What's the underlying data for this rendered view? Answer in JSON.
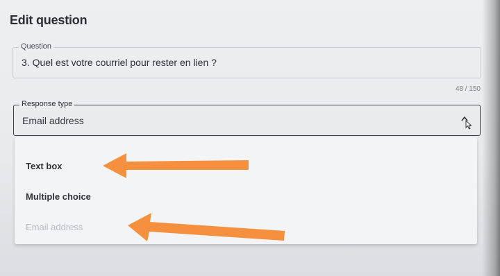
{
  "page_title": "Edit question",
  "question": {
    "legend": "Question",
    "value": "3. Quel est votre courriel pour rester en lien ?",
    "counter": "48 / 150"
  },
  "response_type": {
    "legend": "Response type",
    "selected": "Email address"
  },
  "options": [
    {
      "label": "Text box"
    },
    {
      "label": "Multiple choice"
    },
    {
      "label": "Email address"
    }
  ],
  "colors": {
    "arrow": "#f5913e",
    "field_border": "#3a3d42",
    "disabled_text": "#b9bbbf"
  },
  "icons": [
    "chevron-up-icon",
    "mouse-cursor-icon",
    "arrow-left-annotation"
  ]
}
